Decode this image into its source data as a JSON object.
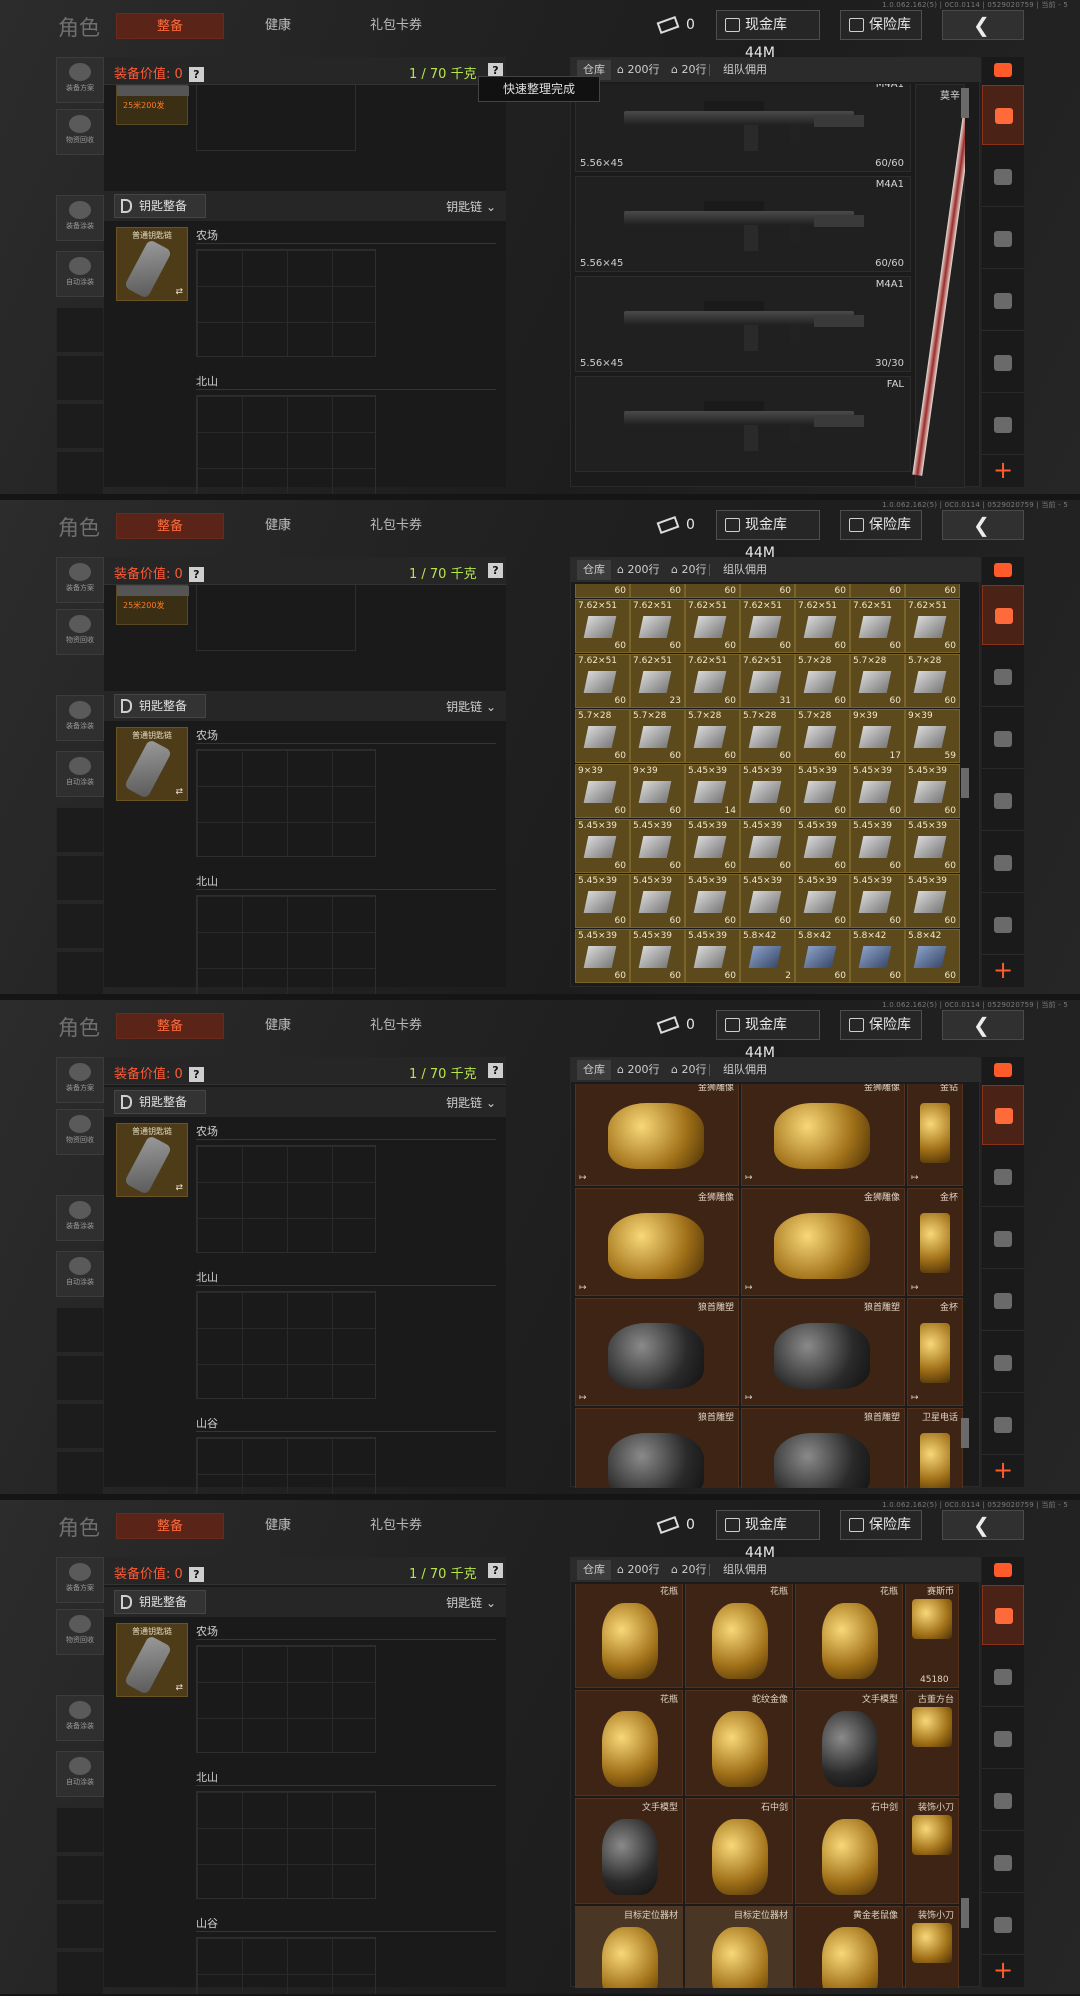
{
  "build_code": "1.0.062.162(5) | 0C0.0114 | 0529020759 | 当前 - 5",
  "topbar": {
    "title": "角色",
    "tabs": [
      "整备",
      "健康",
      "礼包卡券"
    ],
    "ticket_count": "0",
    "cash_label": "现金库 44M",
    "safe_label": "保险库"
  },
  "left_buttons": [
    "装备方案",
    "物资回收",
    "装备涂装",
    "自动涂装"
  ],
  "equip": {
    "value_label": "装备价值: 0",
    "weight": "1 / 70 千克",
    "help": "?",
    "key_button": "钥匙整备",
    "keychain": "钥匙链",
    "key_card": "普通钥匙链",
    "part_label": "25米200发",
    "maps": [
      "农场",
      "北山",
      "山谷"
    ]
  },
  "tooltip": "快速整理完成",
  "stash": {
    "tabs": [
      "仓库",
      "200行",
      "20行",
      "组队佣用"
    ]
  },
  "weapons": [
    {
      "name": "M4A1",
      "caliber": "5.56×45",
      "ammo": "60/60"
    },
    {
      "name": "M4A1",
      "caliber": "5.56×45",
      "ammo": "60/60"
    },
    {
      "name": "M4A1",
      "caliber": "5.56×45",
      "ammo": "30/30"
    },
    {
      "name": "FAL",
      "caliber": "",
      "ammo": ""
    }
  ],
  "sniper_name": "莫辛",
  "ammo_rows": [
    {
      "label": "",
      "counts": [
        "60",
        "60",
        "60",
        "60",
        "60",
        "60",
        "60"
      ]
    },
    {
      "label": "7.62×51",
      "counts": [
        "60",
        "60",
        "60",
        "60",
        "60",
        "60",
        "60"
      ]
    },
    {
      "label": "7.62×51",
      "counts": [
        "60",
        "23",
        "60",
        "31",
        "60",
        "60",
        "60"
      ]
    },
    {
      "label": "5.7×28",
      "counts": [
        "60",
        "60",
        "60",
        "60",
        "60",
        "17",
        "59"
      ]
    },
    {
      "label": "9×39",
      "counts": [
        "60",
        "60",
        "14",
        "60",
        "60",
        "60",
        "60"
      ]
    },
    {
      "label": "5.45×39",
      "counts": [
        "60",
        "60",
        "60",
        "60",
        "60",
        "60",
        "60"
      ]
    },
    {
      "label": "5.45×39",
      "counts": [
        "60",
        "60",
        "60",
        "60",
        "60",
        "60",
        "60"
      ]
    },
    {
      "label": "5.45×39",
      "counts": [
        "60",
        "60",
        "60",
        "2",
        "60",
        "60",
        "60"
      ]
    }
  ],
  "ammo_row_names": [
    [
      "",
      "",
      "",
      "",
      "",
      "",
      ""
    ],
    [
      "7.62×51",
      "7.62×51",
      "7.62×51",
      "7.62×51",
      "7.62×51",
      "7.62×51",
      "7.62×51"
    ],
    [
      "7.62×51",
      "7.62×51",
      "7.62×51",
      "7.62×51",
      "5.7×28",
      "5.7×28",
      "5.7×28"
    ],
    [
      "5.7×28",
      "5.7×28",
      "5.7×28",
      "5.7×28",
      "5.7×28",
      "9×39",
      "9×39"
    ],
    [
      "9×39",
      "9×39",
      "5.45×39",
      "5.45×39",
      "5.45×39",
      "5.45×39",
      "5.45×39"
    ],
    [
      "5.45×39",
      "5.45×39",
      "5.45×39",
      "5.45×39",
      "5.45×39",
      "5.45×39",
      "5.45×39"
    ],
    [
      "5.45×39",
      "5.45×39",
      "5.45×39",
      "5.45×39",
      "5.45×39",
      "5.45×39",
      "5.45×39"
    ],
    [
      "5.45×39",
      "5.45×39",
      "5.45×39",
      "5.8×42",
      "5.8×42",
      "5.8×42",
      "5.8×42"
    ]
  ],
  "valuables3": [
    {
      "name": "金狮雕像"
    },
    {
      "name": "金狮雕像"
    },
    {
      "name": "金钻"
    },
    {
      "name": "金狮雕像"
    },
    {
      "name": "金狮雕像"
    },
    {
      "name": "金杯"
    },
    {
      "name": "狼首雕塑"
    },
    {
      "name": "狼首雕塑"
    },
    {
      "name": "金杯"
    },
    {
      "name": "狼首雕塑"
    },
    {
      "name": "狼首雕塑"
    },
    {
      "name": "卫星电话"
    }
  ],
  "valuables4": [
    {
      "name": "花瓶"
    },
    {
      "name": "花瓶"
    },
    {
      "name": "花瓶"
    },
    {
      "name": "赛斯币",
      "amount": "45180"
    },
    {
      "name": "花瓶"
    },
    {
      "name": "蛇纹金像"
    },
    {
      "name": "文手模型"
    },
    {
      "name": "古董方台"
    },
    {
      "name": "文手模型"
    },
    {
      "name": "石中剑"
    },
    {
      "name": "石中剑"
    },
    {
      "name": "装饰小刀"
    },
    {
      "name": "目标定位器材"
    },
    {
      "name": "目标定位器材"
    },
    {
      "name": "黄金老鼠像"
    },
    {
      "name": "装饰小刀"
    }
  ]
}
